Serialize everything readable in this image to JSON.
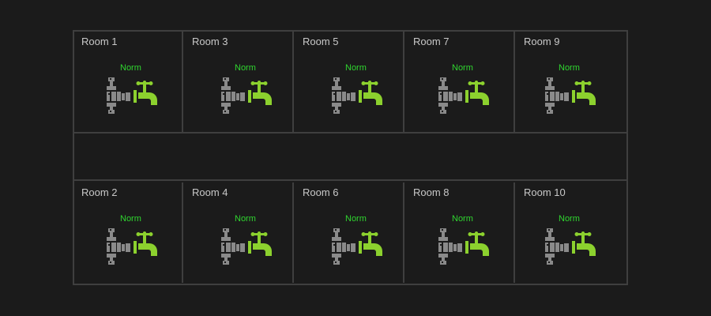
{
  "colors": {
    "background": "#1b1b1b",
    "wall": "#3f3f3f",
    "label": "#c8c8c8",
    "status_ok": "#2fd62f",
    "pipe": "#8a8a8a",
    "faucet": "#8cd12e"
  },
  "rooms_top": [
    {
      "label": "Room 1",
      "status": "Norm",
      "icon": "water-valve-icon"
    },
    {
      "label": "Room 3",
      "status": "Norm",
      "icon": "water-valve-icon"
    },
    {
      "label": "Room 5",
      "status": "Norm",
      "icon": "water-valve-icon"
    },
    {
      "label": "Room 7",
      "status": "Norm",
      "icon": "water-valve-icon"
    },
    {
      "label": "Room 9",
      "status": "Norm",
      "icon": "water-valve-icon"
    }
  ],
  "rooms_bottom": [
    {
      "label": "Room 2",
      "status": "Norm",
      "icon": "water-valve-icon"
    },
    {
      "label": "Room 4",
      "status": "Norm",
      "icon": "water-valve-icon"
    },
    {
      "label": "Room 6",
      "status": "Norm",
      "icon": "water-valve-icon"
    },
    {
      "label": "Room 8",
      "status": "Norm",
      "icon": "water-valve-icon"
    },
    {
      "label": "Room 10",
      "status": "Norm",
      "icon": "water-valve-icon"
    }
  ]
}
